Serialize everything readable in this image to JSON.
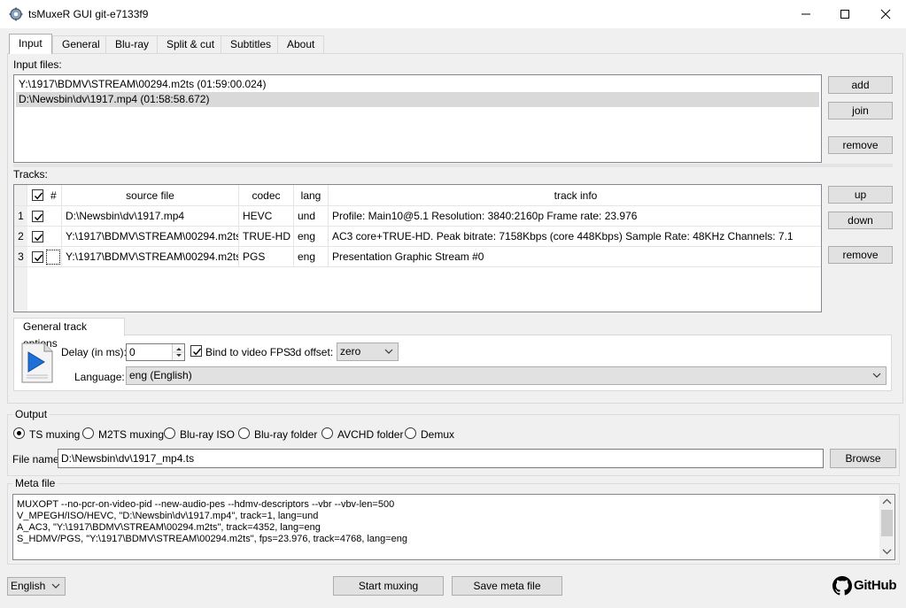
{
  "window": {
    "title": "tsMuxeR GUI git-e7133f9"
  },
  "tabs": [
    {
      "label": "Input",
      "active": true
    },
    {
      "label": "General"
    },
    {
      "label": "Blu-ray"
    },
    {
      "label": "Split & cut"
    },
    {
      "label": "Subtitles"
    },
    {
      "label": "About"
    }
  ],
  "input_files": {
    "label": "Input files:",
    "items": [
      "Y:\\1917\\BDMV\\STREAM\\00294.m2ts (01:59:00.024)",
      "D:\\Newsbin\\dv\\1917.mp4 (01:58:58.672)"
    ],
    "selected_index": 1,
    "buttons": {
      "add": "add",
      "join": "join",
      "remove": "remove"
    }
  },
  "tracks": {
    "label": "Tracks:",
    "columns": {
      "num": "#",
      "source": "source file",
      "codec": "codec",
      "lang": "lang",
      "info": "track info"
    },
    "rows": [
      {
        "num": "1",
        "source": "D:\\Newsbin\\dv\\1917.mp4",
        "codec": "HEVC",
        "lang": "und",
        "info": "Profile: Main10@5.1 Resolution: 3840:2160p  Frame rate: 23.976"
      },
      {
        "num": "2",
        "source": "Y:\\1917\\BDMV\\STREAM\\00294.m2ts",
        "codec": "TRUE-HD",
        "lang": "eng",
        "info": "AC3 core+TRUE-HD. Peak bitrate: 7158Kbps (core 448Kbps) Sample Rate: 48KHz Channels: 7.1"
      },
      {
        "num": "3",
        "source": "Y:\\1917\\BDMV\\STREAM\\00294.m2ts",
        "codec": "PGS",
        "lang": "eng",
        "info": "Presentation Graphic Stream #0"
      }
    ],
    "buttons": {
      "up": "up",
      "down": "down",
      "remove": "remove"
    }
  },
  "track_options": {
    "tab_label": "General track options",
    "delay_label": "Delay (in ms):",
    "delay_value": "0",
    "bind_fps_label": "Bind to video FPS",
    "offset_label": "3d offset:",
    "offset_value": "zero",
    "language_label": "Language:",
    "language_value": "eng (English)"
  },
  "output": {
    "label": "Output",
    "modes": [
      "TS muxing",
      "M2TS muxing",
      "Blu-ray ISO",
      "Blu-ray folder",
      "AVCHD folder",
      "Demux"
    ],
    "selected_mode": 0,
    "file_name_label": "File name",
    "file_name_value": "D:\\Newsbin\\dv\\1917_mp4.ts",
    "browse_label": "Browse"
  },
  "meta": {
    "label": "Meta file",
    "lines": [
      "MUXOPT --no-pcr-on-video-pid --new-audio-pes --hdmv-descriptors --vbr  --vbv-len=500",
      "V_MPEGH/ISO/HEVC, \"D:\\Newsbin\\dv\\1917.mp4\", track=1, lang=und",
      "A_AC3, \"Y:\\1917\\BDMV\\STREAM\\00294.m2ts\", track=4352, lang=eng",
      "S_HDMV/PGS, \"Y:\\1917\\BDMV\\STREAM\\00294.m2ts\", fps=23.976, track=4768, lang=eng"
    ]
  },
  "footer": {
    "language_select": "English",
    "start_label": "Start muxing",
    "save_meta_label": "Save meta file",
    "github_label": "GitHub"
  },
  "colors": {
    "selected_row": "#d9d9d9",
    "button_face": "#e1e1e1",
    "accent_icon": "#1f6fd6"
  }
}
